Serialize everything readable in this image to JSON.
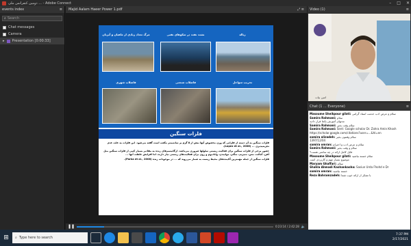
{
  "window": {
    "title": "دومین کنفرانس ملی ... - Adobe Connect"
  },
  "left_panel": {
    "title": "events index",
    "search_placeholder": "Search",
    "items": [
      {
        "label": "Chat messages"
      },
      {
        "label": "Camera"
      },
      {
        "label": "Presentation [0:00:33]"
      }
    ]
  },
  "center": {
    "title": "Majid Aalam Haeer Power 1.pdf",
    "slide": {
      "captions": [
        "مرگ تعداد زیادی از ماهیان و آبزیان",
        "نشت نفت در سکوهای نفتی",
        "زباله",
        "فاضلاب شهری",
        "فاضلاب صنعتی",
        "تخریب سواحل"
      ],
      "section_title": "فلزات سنگین",
      "paragraphs": [
        "فلزات سنگین به آن دسته از فلزاتی که وزن مخصوص آنها بیش از ۵ گرم بر سانتیمتر مکعب است گفته می‌شود. این فلزات به علت عدم تجزیه‌پذیری ... (Lopez et al., 2006).",
        "حضور برخی از فلزات سنگین برای فعالیت زیستی سلولها ضروری می‌باشد. ارگانیسم‌های زنده به مقادیر بسیار کمی از فلزات سنگین مثل آهن، کبالت، مس، منیزیم، منگنز، مولیبدن، وانادیوم و روی برای فعالیت‌های زیستی نیاز دارند، اما افزایش غلظت آنها ...",
        "فلزات سنگین از جمله مهمترین آلاینده‌های محیط زیست به شمار می‌روند که ... در موجودات زنده (Parka et al., 2008)."
      ]
    }
  },
  "video": {
    "title": "Video (1)",
    "caption": "امین بیات"
  },
  "chat": {
    "title": "Chat (1 ... Everyone)",
    "lines": [
      {
        "name": "Masoume Sheikpour gilati",
        "text": "سلام و عرض ادب خدمت استاد گرامی"
      },
      {
        "name": "Samira Rahmani",
        "text": "سلام"
      },
      {
        "name": "",
        "text": "مدتهای آموزش یکجا قرار دادید"
      },
      {
        "name": "Samira Rahmani",
        "text": "سلام وقت بخیر"
      },
      {
        "name": "Samira Rahmani",
        "text": "Sent: Google scholar Dr. Zahra Amin Khosh"
      },
      {
        "name": "",
        "text": "https://scholar.google.com/citations?user=...&hl=en"
      },
      {
        "name": "samira alizadeh",
        "text": "سلام وقتتون بخیر"
      },
      {
        "name": "",
        "text": "1397/12/04"
      },
      {
        "name": "samira omran",
        "text": "سلام و عرض ادب و احترام"
      },
      {
        "name": "Samira Rahmani",
        "text": "سلام و وقت بخیر"
      },
      {
        "name": "",
        "text": "فایل کامل ارائه در چه ساعتی هست؟"
      },
      {
        "name": "Masoume Sheikpour gilati",
        "text": "سلام خسته نباشید"
      },
      {
        "name": "",
        "text": "موضوع بسیار مهم و کاربردی است"
      },
      {
        "name": "Maryam Ghaffari",
        "text": "سلام"
      },
      {
        "name": "Shahla Ahmadi Kashankasha",
        "text": "Sasiun Urda Fhohd e Dr"
      },
      {
        "name": "samira omran",
        "text": "خسته نباشید"
      },
      {
        "name": "Reza Bahramzadeh",
        "text": "با تشکر از ارائه خوب شما"
      }
    ]
  },
  "playbar": {
    "time": "0:23:14 / 2:42:28",
    "progress": 0.14
  },
  "taskbar": {
    "search_placeholder": "Type here to search",
    "time": "7:37 PM",
    "date": "2/17/2021"
  }
}
